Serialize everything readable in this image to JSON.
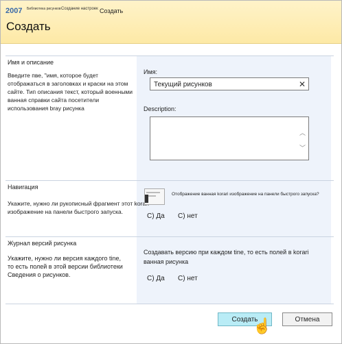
{
  "header": {
    "brand": "2007",
    "breadcrumb_small_1": "Библиотека рисунков",
    "breadcrumb_small_2": "Создание настроек",
    "breadcrumb_current": "Создать",
    "title": "Создать"
  },
  "sections": {
    "name": {
      "title": "Имя и описание",
      "description": "Введите пве, \"имя, которое будет отображаться в заголовках и краски на этом сайте. Тип описания текст, который военными ванная справки сайта посетители использования bray рисунка",
      "name_label": "Имя:",
      "name_value": "Текущий рисунков",
      "desc_label": "Description:"
    },
    "nav": {
      "title": "Навигация",
      "description": "Укажите, нужно ли рукописный фрагмент этот korari изображение на панели быстрого запуска.",
      "question": "Отображение ванная korari изображение на панели быстрого запуска?",
      "yes": "С) Да",
      "no": "С) нет"
    },
    "versions": {
      "title": "Журнал версий рисунка",
      "description": "Укажите, нужно ли версия каждого tine, то есть полей в этой версии библиотеки Сведения о рисунков.",
      "question": "Создавать версию при каждом tine, то есть полей в korari ванная рисунка",
      "yes": "С) Да",
      "no": "С) нет"
    }
  },
  "buttons": {
    "create": "Создать",
    "cancel": "Отмена"
  }
}
